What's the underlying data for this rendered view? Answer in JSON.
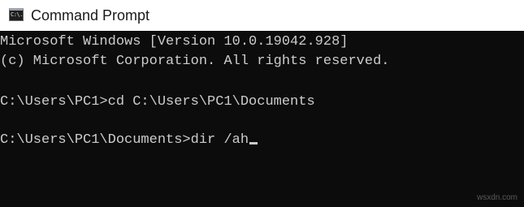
{
  "window": {
    "title": "Command Prompt",
    "icon": "command-prompt-icon",
    "icon_glyph": "C:\\."
  },
  "console": {
    "background_color": "#0c0c0c",
    "text_color": "#cccccc",
    "lines": [
      "Microsoft Windows [Version 10.0.19042.928]",
      "(c) Microsoft Corporation. All rights reserved.",
      "",
      "C:\\Users\\PC1>cd C:\\Users\\PC1\\Documents",
      "",
      "C:\\Users\\PC1\\Documents>dir /ah"
    ]
  },
  "watermark": "wsxdn.com"
}
